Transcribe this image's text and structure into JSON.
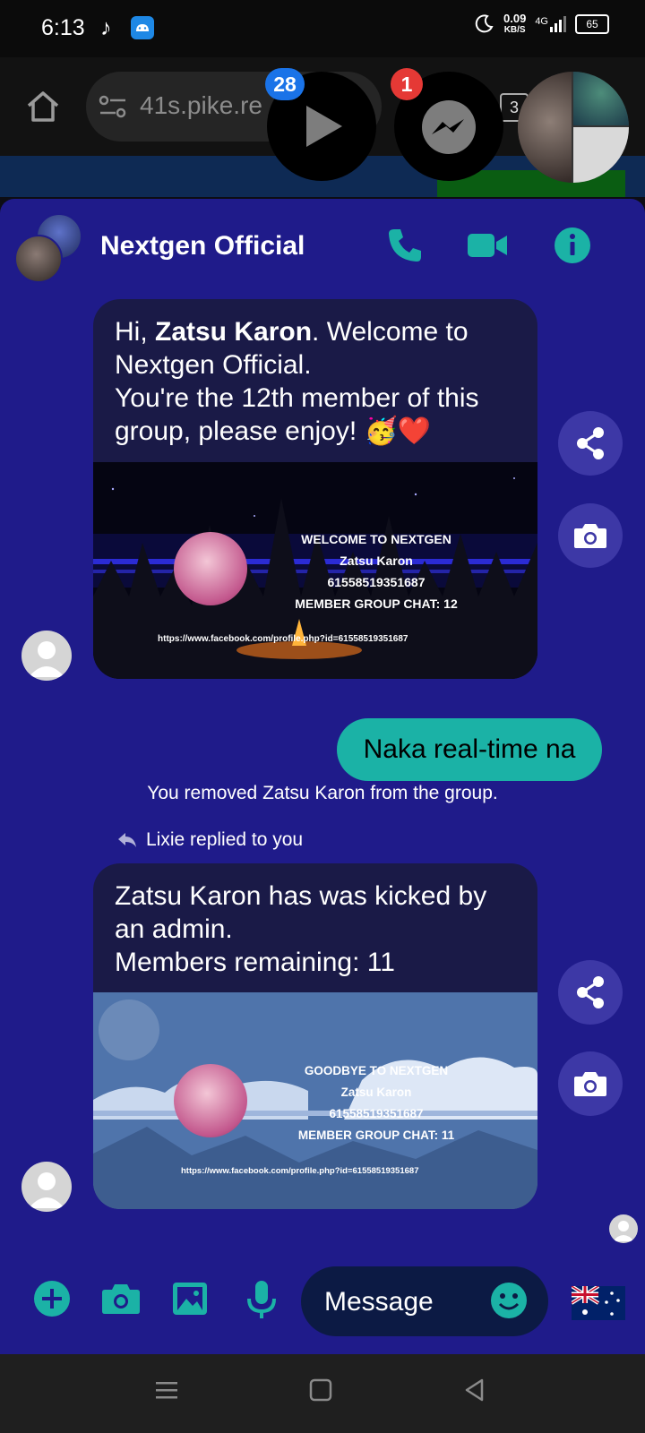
{
  "status_bar": {
    "time": "6:13",
    "speed_value": "0.09",
    "speed_unit": "KB/S",
    "network": "4G",
    "battery": "65"
  },
  "browser": {
    "url": "41s.pike.re",
    "tab_count": "3"
  },
  "bubbles": {
    "video_badge": "28",
    "messenger_badge": "1"
  },
  "chat": {
    "title": "Nextgen Official",
    "welcome": {
      "greeting": "Hi, ",
      "name": "Zatsu Karon",
      "rest": ". Welcome to Nextgen Official.",
      "line2": "You're the 12th member of this group, please enjoy! 🥳❤️",
      "banner_title": "WELCOME TO NEXTGEN",
      "banner_name": "Zatsu Karon",
      "banner_id": "61558519351687",
      "banner_count": "MEMBER GROUP CHAT: 12",
      "banner_url": "https://www.facebook.com/profile.php?id=61558519351687"
    },
    "sent_message": "Naka real-time na",
    "system_message": "You removed Zatsu Karon from the group.",
    "reply_label": "Lixie replied to you",
    "goodbye": {
      "line1": "Zatsu Karon has was kicked by an admin.",
      "line2": "Members remaining: 11",
      "banner_title": "GOODBYE TO NEXTGEN",
      "banner_name": "Zatsu Karon",
      "banner_id": "61558519351687",
      "banner_count": "MEMBER GROUP CHAT: 11",
      "banner_url": "https://www.facebook.com/profile.php?id=61558519351687"
    },
    "input_placeholder": "Message"
  },
  "colors": {
    "panel": "#1f1b8a",
    "accent": "#1bb2a6",
    "bubble_dark": "#1a1a47"
  }
}
